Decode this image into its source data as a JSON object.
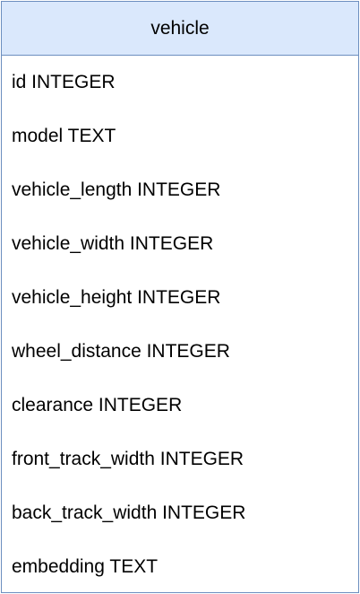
{
  "table": {
    "title": "vehicle",
    "header_fill": "#dae8fc",
    "border_color": "#6c8ebf",
    "fields": [
      "id INTEGER",
      "model TEXT",
      "vehicle_length INTEGER",
      "vehicle_width INTEGER",
      "vehicle_height INTEGER",
      "wheel_distance INTEGER",
      "clearance INTEGER",
      "front_track_width INTEGER",
      "back_track_width INTEGER",
      "embedding TEXT"
    ]
  }
}
